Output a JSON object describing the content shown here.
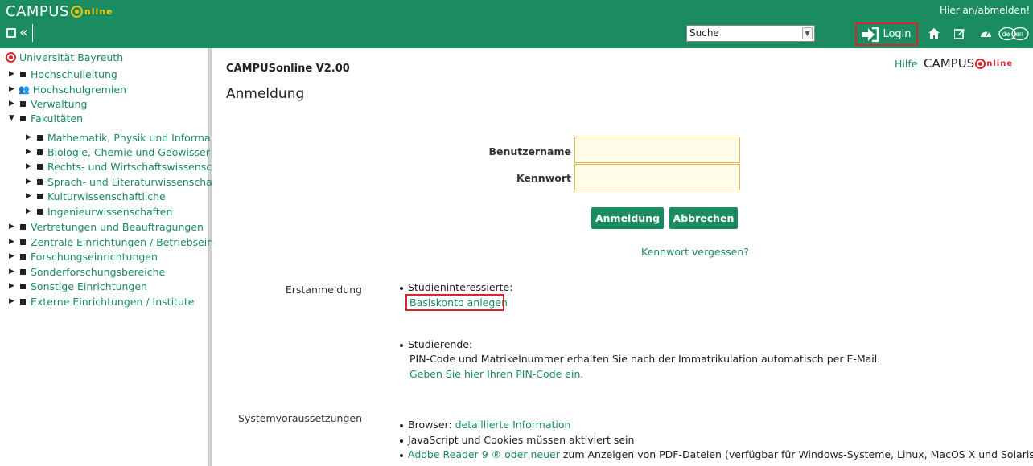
{
  "header": {
    "logo_main": "CAMPUS",
    "logo_tail": "nline",
    "collapse_glyph": "«",
    "search_select": "Suche",
    "hier_an": "Hier an/abmelden!",
    "login_label": "Login",
    "icons": [
      "login-arrow-icon",
      "home-icon",
      "edit-icon",
      "dashboard-icon",
      "language-de-en-icon"
    ]
  },
  "sidebar": {
    "root": "Universität Bayreuth",
    "items": [
      {
        "label": "Hochschulleitung"
      },
      {
        "label": "Hochschulgremien"
      },
      {
        "label": "Verwaltung"
      },
      {
        "label": "Fakultäten"
      },
      {
        "label": "Mathematik, Physik und Informa"
      },
      {
        "label": "Biologie, Chemie und Geowisser"
      },
      {
        "label": "Rechts- und Wirtschaftswissensc"
      },
      {
        "label": "Sprach- und Literaturwissenscha"
      },
      {
        "label": "Kulturwissenschaftliche"
      },
      {
        "label": "Ingenieurwissenschaften"
      },
      {
        "label": "Vertretungen und Beauftragungen"
      },
      {
        "label": "Zentrale Einrichtungen / Betriebsein"
      },
      {
        "label": "Forschungseinrichtungen"
      },
      {
        "label": "Sonderforschungsbereiche"
      },
      {
        "label": "Sonstige Einrichtungen"
      },
      {
        "label": "Externe Einrichtungen / Institute"
      }
    ]
  },
  "main": {
    "version": "CAMPUSonline V2.00",
    "title": "Anmeldung",
    "hilfe": "Hilfe",
    "logo_small_main": "CAMPUS",
    "logo_small_tail": "nline",
    "username_label": "Benutzername",
    "password_label": "Kennwort",
    "login_button": "Anmeldung",
    "cancel_button": "Abbrechen",
    "forgot_link": "Kennwort vergessen?",
    "erstanmeldung_label": "Erstanmeldung",
    "studieninteressierte": "Studieninteressierte:",
    "basiskonto_link": "Basiskonto anlegen",
    "studierende": "Studierende:",
    "pin_text": "PIN-Code und Matrikelnummer erhalten Sie nach der Immatrikulation automatisch per E-Mail.",
    "pin_link": "Geben Sie hier Ihren PIN-Code ein.",
    "system_label": "Systemvoraussetzungen",
    "browser_prefix": "Browser: ",
    "browser_link": "detaillierte Information",
    "js_text": "JavaScript und Cookies müssen aktiviert sein",
    "adobe_link": "Adobe Reader 9 ® oder neuer",
    "adobe_text": " zum Anzeigen von PDF-Dateien (verfügbar für Windows-Systeme, Linux, MacOS X und Solaris)."
  }
}
